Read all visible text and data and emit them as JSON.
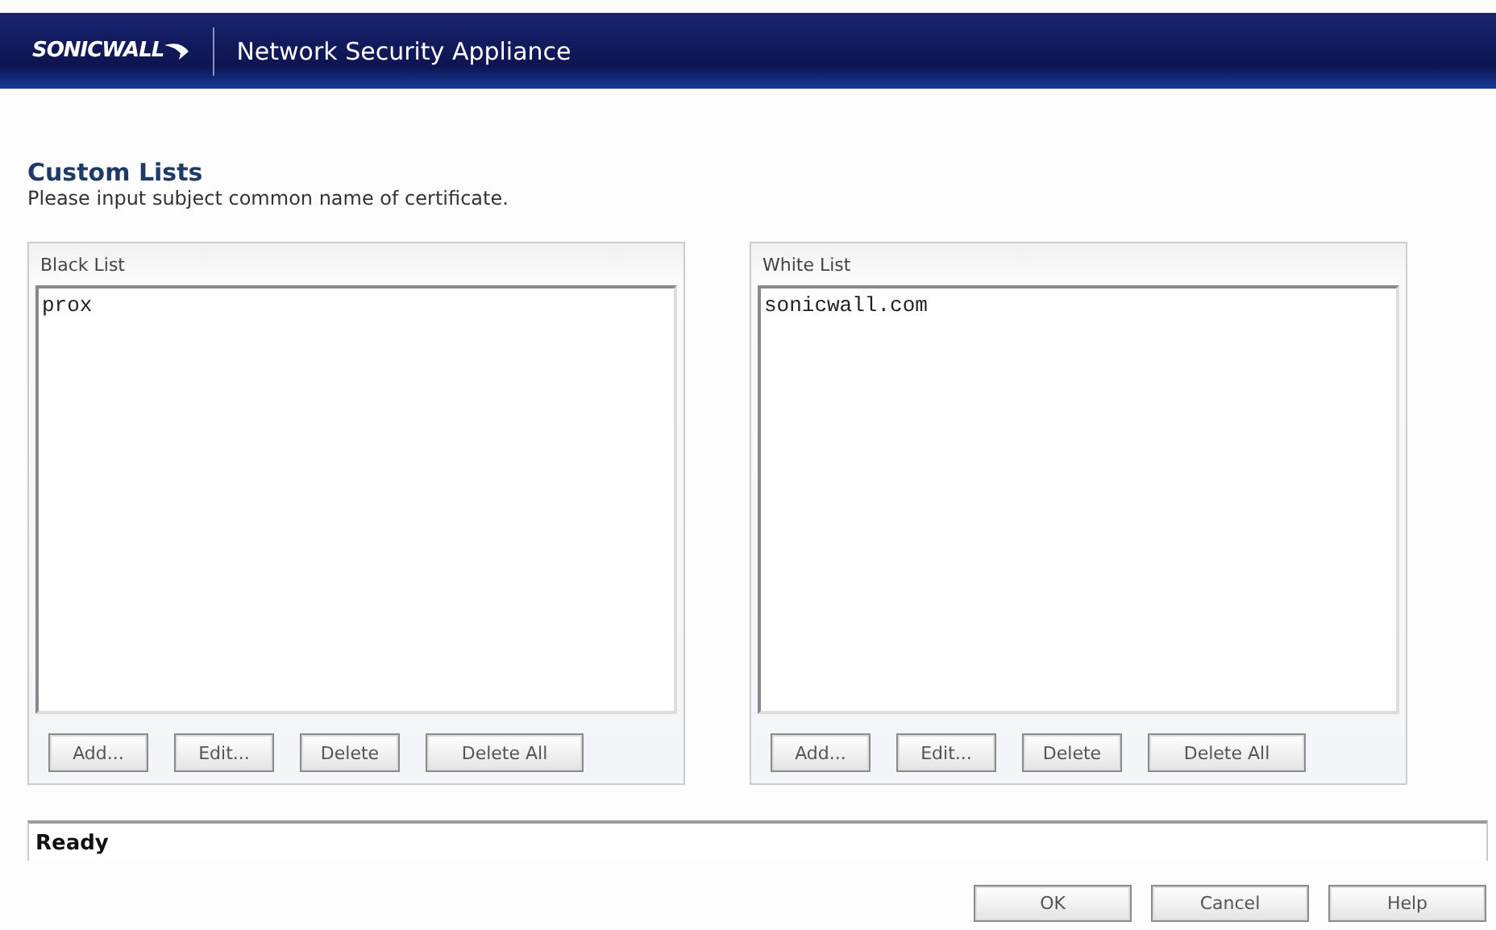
{
  "header": {
    "logo": "SONICWALL",
    "title": "Network Security Appliance"
  },
  "page": {
    "title": "Custom Lists",
    "subtitle": "Please input subject common name of certificate."
  },
  "lists": [
    {
      "title": "Black List",
      "entries": [
        "prox"
      ],
      "buttons": [
        "Add...",
        "Edit...",
        "Delete",
        "Delete All"
      ]
    },
    {
      "title": "White List",
      "entries": [
        "sonicwall.com"
      ],
      "buttons": [
        "Add...",
        "Edit...",
        "Delete",
        "Delete All"
      ]
    }
  ],
  "status_bar": "Ready",
  "buttons": [
    "OK",
    "Cancel",
    "Help"
  ]
}
